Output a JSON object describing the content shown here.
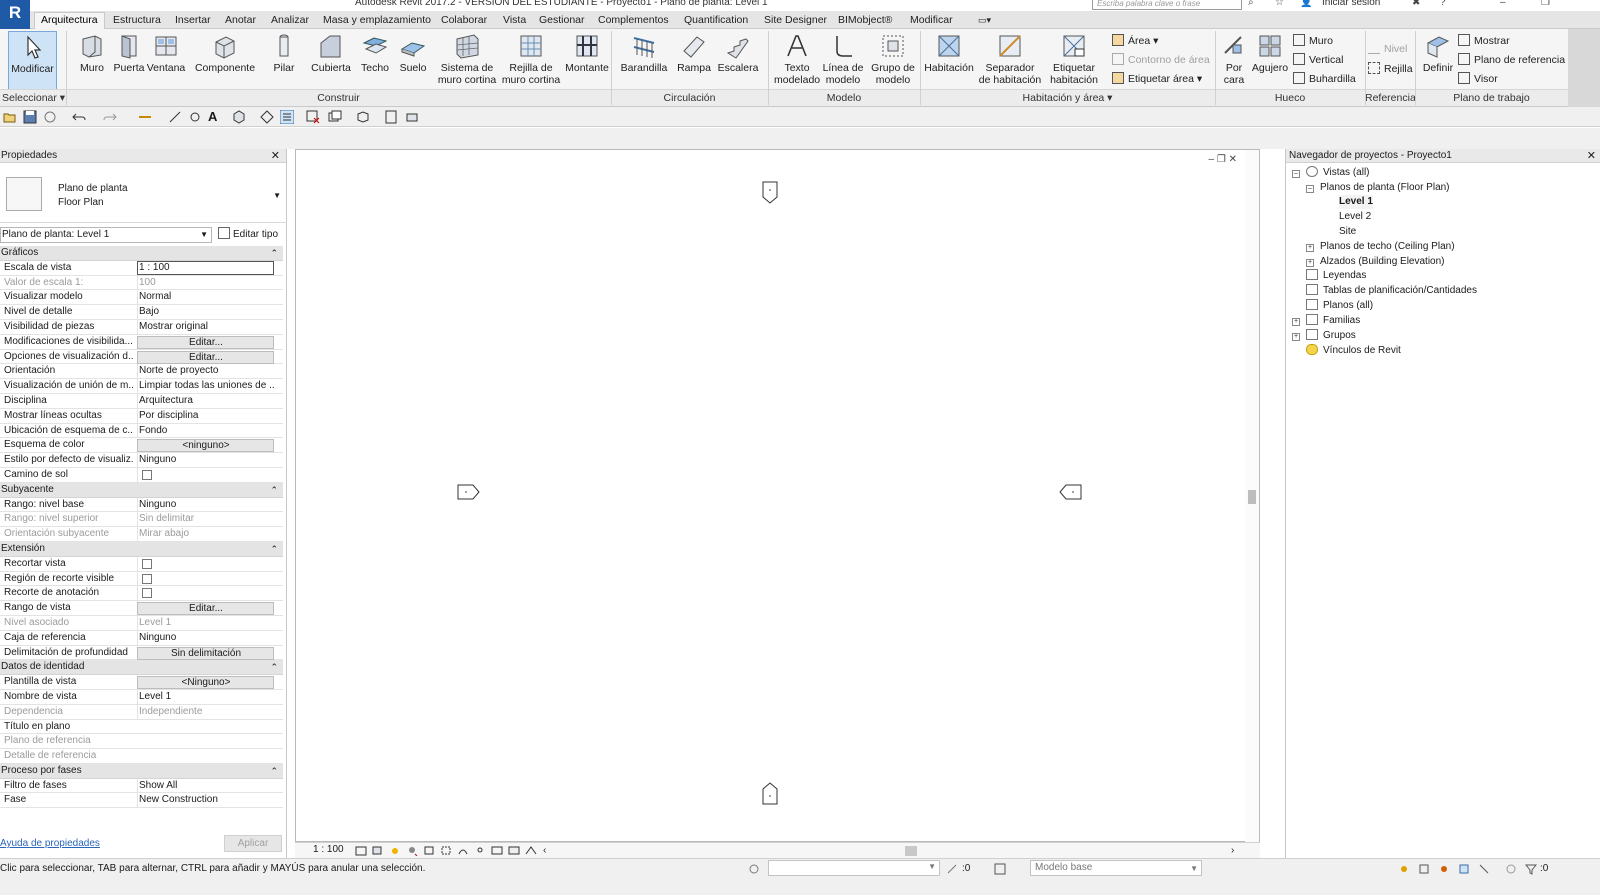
{
  "titlebar": {
    "title": "Autodesk Revit 2017.2 -  VERSIÓN DEL ESTUDIANTE  -     Proyecto1 - Plano de planta: Level 1",
    "search_placeholder": "Escriba palabra clave o frase",
    "signin": "Iniciar sesión",
    "logo": "R"
  },
  "tabs": [
    "Arquitectura",
    "Estructura",
    "Insertar",
    "Anotar",
    "Analizar",
    "Masa y emplazamiento",
    "Colaborar",
    "Vista",
    "Gestionar",
    "Complementos",
    "Quantification",
    "Site Designer",
    "BIMobject®",
    "Modificar"
  ],
  "ribbon": {
    "buttons": {
      "modificar": "Modificar",
      "muro": "Muro",
      "puerta": "Puerta",
      "ventana": "Ventana",
      "componente": "Componente",
      "pilar": "Pilar",
      "cubierta": "Cubierta",
      "techo": "Techo",
      "suelo": "Suelo",
      "sistema": "Sistema de\nmuro cortina",
      "rejilla": "Rejilla de\nmuro cortina",
      "montante": "Montante",
      "barandilla": "Barandilla",
      "rampa": "Rampa",
      "escalera": "Escalera",
      "texto": "Texto\nmodelado",
      "linea": "Línea de\nmodelo",
      "grupo": "Grupo de\nmodelo",
      "habitacion": "Habitación",
      "separador": "Separador\nde habitación",
      "etiquetar_hab": "Etiquetar\nhabitación",
      "por_cara": "Por\ncara",
      "agujero": "Agujero",
      "definir": "Definir"
    },
    "small": {
      "area": "Área",
      "contorno": "Contorno de área",
      "etiquetar_area": "Etiquetar  área",
      "muro": "Muro",
      "vertical": "Vertical",
      "buhardilla": "Buhardilla",
      "nivel": "Nivel",
      "rejilla": "Rejilla",
      "mostrar": "Mostrar",
      "plano_ref": "Plano de referencia",
      "visor": "Visor"
    },
    "panels": {
      "seleccionar": "Seleccionar",
      "construir": "Construir",
      "circulacion": "Circulación",
      "modelo": "Modelo",
      "habitacion_area": "Habitación y área",
      "hueco": "Hueco",
      "referencia": "Referencia",
      "plano_trabajo": "Plano de trabajo"
    }
  },
  "properties": {
    "title": "Propiedades",
    "type_line1": "Plano de planta",
    "type_line2": "Floor Plan",
    "instance_filter": "Plano de planta: Level 1",
    "edit_type": "Editar tipo",
    "help_link": "Ayuda de propiedades",
    "apply": "Aplicar",
    "sections": {
      "graficos": "Gráficos",
      "subyacente": "Subyacente",
      "extension": "Extensión",
      "identidad": "Datos de identidad",
      "fases": "Proceso por fases"
    },
    "rows": {
      "r1": {
        "name": "Escala de vista",
        "value": "1 : 100"
      },
      "r2": {
        "name": "Valor de escala    1:",
        "value": "100"
      },
      "r3": {
        "name": "Visualizar modelo",
        "value": "Normal"
      },
      "r4": {
        "name": "Nivel de detalle",
        "value": "Bajo"
      },
      "r5": {
        "name": "Visibilidad de piezas",
        "value": "Mostrar original"
      },
      "r6": {
        "name": "Modificaciones de visibilida...",
        "value": "Editar..."
      },
      "r7": {
        "name": "Opciones de visualización d...",
        "value": "Editar..."
      },
      "r8": {
        "name": "Orientación",
        "value": "Norte de proyecto"
      },
      "r9": {
        "name": "Visualización de unión de m...",
        "value": "Limpiar todas las uniones de ..."
      },
      "r10": {
        "name": "Disciplina",
        "value": "Arquitectura"
      },
      "r11": {
        "name": "Mostrar líneas ocultas",
        "value": "Por disciplina"
      },
      "r12": {
        "name": "Ubicación de esquema de c...",
        "value": "Fondo"
      },
      "r13": {
        "name": "Esquema de color",
        "value": "<ninguno>"
      },
      "r14": {
        "name": "Estilo por defecto de visualiz...",
        "value": "Ninguno"
      },
      "r15": {
        "name": "Camino de sol",
        "value": ""
      },
      "s1": {
        "name": "Rango: nivel base",
        "value": "Ninguno"
      },
      "s2": {
        "name": "Rango: nivel superior",
        "value": "Sin delimitar"
      },
      "s3": {
        "name": "Orientación subyacente",
        "value": "Mirar abajo"
      },
      "e1": {
        "name": "Recortar vista",
        "value": ""
      },
      "e2": {
        "name": "Región de recorte visible",
        "value": ""
      },
      "e3": {
        "name": "Recorte de anotación",
        "value": ""
      },
      "e4": {
        "name": "Rango de vista",
        "value": "Editar..."
      },
      "e5": {
        "name": "Nivel asociado",
        "value": "Level 1"
      },
      "e6": {
        "name": "Caja de referencia",
        "value": "Ninguno"
      },
      "e7": {
        "name": "Delimitación de profundidad",
        "value": "Sin delimitación"
      },
      "d1": {
        "name": "Plantilla de vista",
        "value": "<Ninguno>"
      },
      "d2": {
        "name": "Nombre de vista",
        "value": "Level 1"
      },
      "d3": {
        "name": "Dependencia",
        "value": "Independiente"
      },
      "d4": {
        "name": "Título en plano",
        "value": ""
      },
      "d5": {
        "name": "Plano de referencia",
        "value": ""
      },
      "d6": {
        "name": "Detalle de referencia",
        "value": ""
      },
      "f1": {
        "name": "Filtro de fases",
        "value": "Show All"
      },
      "f2": {
        "name": "Fase",
        "value": "New Construction"
      }
    }
  },
  "viewbar": {
    "scale": "1 : 100"
  },
  "browser": {
    "title": "Navegador de proyectos - Proyecto1",
    "nodes": {
      "vistas": "Vistas (all)",
      "planos_planta": "Planos de planta (Floor Plan)",
      "level1": "Level 1",
      "level2": "Level 2",
      "site": "Site",
      "planos_techo": "Planos de techo (Ceiling Plan)",
      "alzados": "Alzados (Building Elevation)",
      "leyendas": "Leyendas",
      "tablas": "Tablas de planificación/Cantidades",
      "planos": "Planos (all)",
      "familias": "Familias",
      "grupos": "Grupos",
      "vinculos": "Vínculos de Revit"
    }
  },
  "statusbar": {
    "text": "Clic para seleccionar, TAB para alternar, CTRL para añadir y MAYÚS para anular una selección.",
    "worksets_count": ":0",
    "model": "Modelo base",
    "filter_count": ":0"
  },
  "colors": {
    "accent": "#1f5aa6",
    "selection": "#cfe3f7"
  }
}
